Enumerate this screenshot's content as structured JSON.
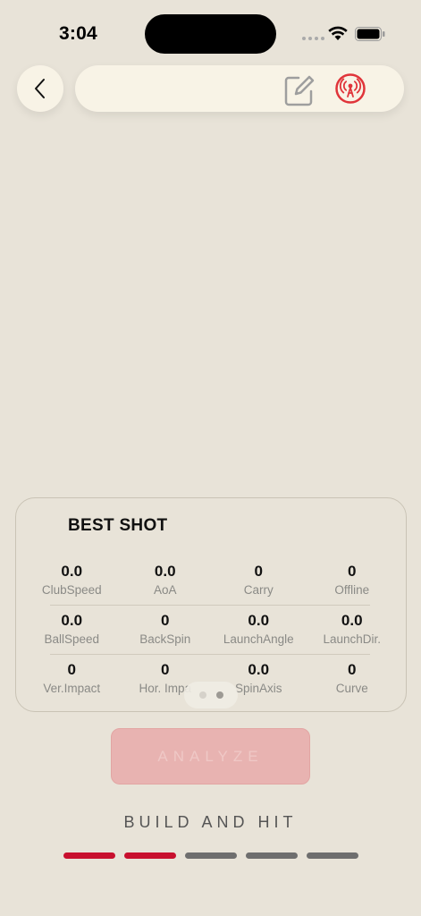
{
  "status_bar": {
    "time": "3:04"
  },
  "header": {
    "back_icon": "chevron-left-icon",
    "edit_icon": "edit-icon",
    "broadcast_icon": "broadcast-icon",
    "broadcast_color": "#e0343a"
  },
  "best_shot": {
    "title": "BEST SHOT",
    "rows": [
      [
        {
          "value": "0.0",
          "label": "ClubSpeed"
        },
        {
          "value": "0.0",
          "label": "AoA"
        },
        {
          "value": "0",
          "label": "Carry"
        },
        {
          "value": "0",
          "label": "Offline"
        }
      ],
      [
        {
          "value": "0.0",
          "label": "BallSpeed"
        },
        {
          "value": "0",
          "label": "BackSpin"
        },
        {
          "value": "0.0",
          "label": "LaunchAngle"
        },
        {
          "value": "0.0",
          "label": "LaunchDir."
        }
      ],
      [
        {
          "value": "0",
          "label": "Ver.Impact"
        },
        {
          "value": "0",
          "label": "Hor. Impa"
        },
        {
          "value": "0.0",
          "label": "SpinAxis"
        },
        {
          "value": "0",
          "label": "Curve"
        }
      ]
    ],
    "pager": {
      "pages": 2,
      "active": 2
    }
  },
  "analyze_label": "ANALYZE",
  "footer": {
    "title": "BUILD AND HIT",
    "steps": [
      {
        "state": "done",
        "color": "#c8102e"
      },
      {
        "state": "done",
        "color": "#c8102e"
      },
      {
        "state": "todo",
        "color": "#6e6e6e"
      },
      {
        "state": "todo",
        "color": "#6e6e6e"
      },
      {
        "state": "todo",
        "color": "#6e6e6e"
      }
    ]
  },
  "colors": {
    "background": "#e8e3d8",
    "accent": "#c8102e",
    "analyze_disabled": "#e8b3b1"
  }
}
